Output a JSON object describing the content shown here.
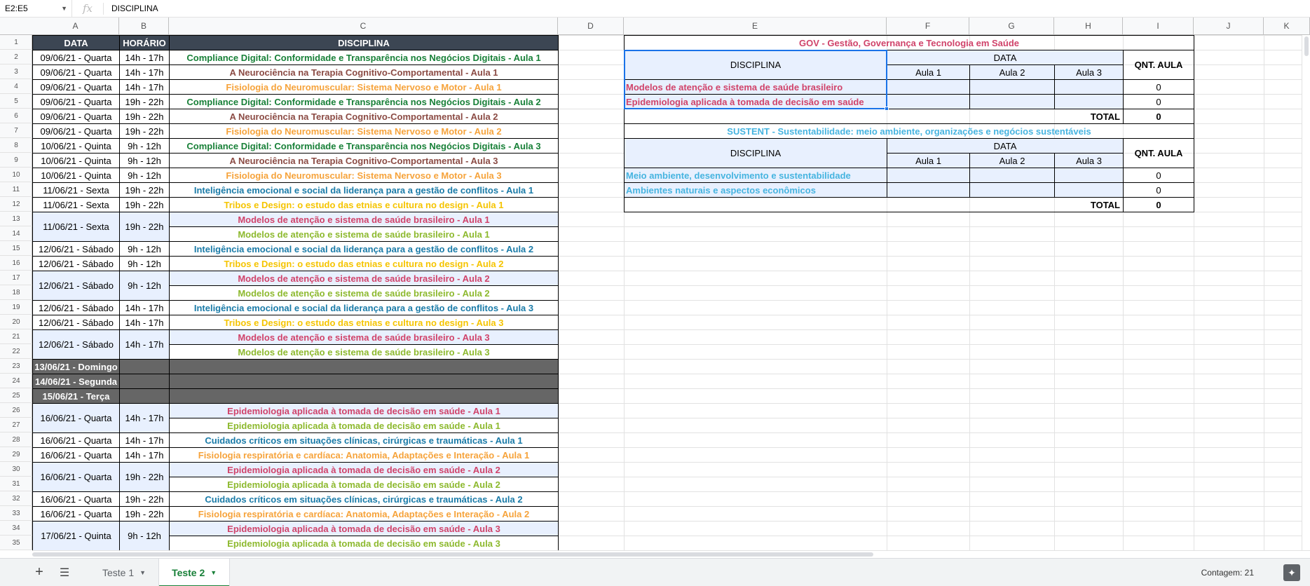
{
  "formula_bar": {
    "cell_ref": "E2:E5",
    "fx": "fx",
    "value": "DISCIPLINA"
  },
  "columns": [
    "A",
    "B",
    "C",
    "D",
    "E",
    "F",
    "G",
    "H",
    "I",
    "J",
    "K"
  ],
  "rows": [
    "1",
    "2",
    "3",
    "4",
    "5",
    "6",
    "7",
    "8",
    "9",
    "10",
    "11",
    "12",
    "13",
    "14",
    "15",
    "16",
    "17",
    "18",
    "19",
    "20",
    "21",
    "22",
    "23",
    "24",
    "25",
    "26",
    "27",
    "28",
    "29",
    "30",
    "31",
    "32",
    "33",
    "34",
    "35"
  ],
  "colors": {
    "green": "#188038",
    "brown": "#8b4b44",
    "orange": "#f6a33b",
    "blue": "#1a7ba8",
    "yellow": "#f5c400",
    "pink": "#d0436a",
    "lime": "#8db92e",
    "gov": "#d0436a",
    "sustent": "#46b4e0"
  },
  "table": {
    "headers": {
      "data": "DATA",
      "horario": "HORÁRIO",
      "disciplina": "DISCIPLINA"
    },
    "rows": [
      {
        "date": "09/06/21 - Quarta",
        "time": "14h - 17h",
        "subject": "Compliance Digital: Conformidade e Transparência nos Negócios Digitais - Aula 1",
        "color": "green"
      },
      {
        "date": "09/06/21 - Quarta",
        "time": "14h - 17h",
        "subject": "A Neurociência na Terapia Cognitivo-Comportamental - Aula 1",
        "color": "brown"
      },
      {
        "date": "09/06/21 - Quarta",
        "time": "14h - 17h",
        "subject": "Fisiologia do Neuromuscular: Sistema Nervoso e Motor - Aula 1",
        "color": "orange"
      },
      {
        "date": "09/06/21 - Quarta",
        "time": "19h - 22h",
        "subject": "Compliance Digital: Conformidade e Transparência nos Negócios Digitais - Aula 2",
        "color": "green"
      },
      {
        "date": "09/06/21 - Quarta",
        "time": "19h - 22h",
        "subject": "A Neurociência na Terapia Cognitivo-Comportamental - Aula 2",
        "color": "brown"
      },
      {
        "date": "09/06/21 - Quarta",
        "time": "19h - 22h",
        "subject": "Fisiologia do Neuromuscular: Sistema Nervoso e Motor - Aula 2",
        "color": "orange"
      },
      {
        "date": "10/06/21 - Quinta",
        "time": "9h - 12h",
        "subject": "Compliance Digital: Conformidade e Transparência nos Negócios Digitais - Aula 3",
        "color": "green"
      },
      {
        "date": "10/06/21 - Quinta",
        "time": "9h - 12h",
        "subject": "A Neurociência na Terapia Cognitivo-Comportamental - Aula 3",
        "color": "brown"
      },
      {
        "date": "10/06/21 - Quinta",
        "time": "9h - 12h",
        "subject": "Fisiologia do Neuromuscular: Sistema Nervoso e Motor - Aula 3",
        "color": "orange"
      },
      {
        "date": "11/06/21 - Sexta",
        "time": "19h - 22h",
        "subject": "Inteligência emocional e social da liderança para a gestão de conflitos - Aula 1",
        "color": "blue"
      },
      {
        "date": "11/06/21 - Sexta",
        "time": "19h - 22h",
        "subject": "Tribos e Design: o estudo das etnias e cultura no design - Aula 1",
        "color": "yellow"
      },
      {
        "date": "11/06/21 - Sexta",
        "time": "19h - 22h",
        "subject": "Modelos de atenção e sistema de saúde brasileiro - Aula 1",
        "color": "pink",
        "merged": true
      },
      {
        "subject": "Modelos de atenção e sistema de saúde brasileiro - Aula 1",
        "color": "lime",
        "merged_cont": true
      },
      {
        "date": "12/06/21 - Sábado",
        "time": "9h - 12h",
        "subject": "Inteligência emocional e social da liderança para a gestão de conflitos - Aula 2",
        "color": "blue"
      },
      {
        "date": "12/06/21 - Sábado",
        "time": "9h - 12h",
        "subject": "Tribos e Design: o estudo das etnias e cultura no design - Aula 2",
        "color": "yellow"
      },
      {
        "date": "12/06/21 - Sábado",
        "time": "9h - 12h",
        "subject": "Modelos de atenção e sistema de saúde brasileiro - Aula 2",
        "color": "pink",
        "merged": true
      },
      {
        "subject": "Modelos de atenção e sistema de saúde brasileiro - Aula 2",
        "color": "lime",
        "merged_cont": true
      },
      {
        "date": "12/06/21 - Sábado",
        "time": "14h - 17h",
        "subject": "Inteligência emocional e social da liderança para a gestão de conflitos - Aula 3",
        "color": "blue"
      },
      {
        "date": "12/06/21 - Sábado",
        "time": "14h - 17h",
        "subject": "Tribos e Design: o estudo das etnias e cultura no design - Aula 3",
        "color": "yellow"
      },
      {
        "date": "12/06/21 - Sábado",
        "time": "14h - 17h",
        "subject": "Modelos de atenção e sistema de saúde brasileiro - Aula 3",
        "color": "pink",
        "merged": true
      },
      {
        "subject": "Modelos de atenção e sistema de saúde brasileiro - Aula 3",
        "color": "lime",
        "merged_cont": true
      },
      {
        "date": "13/06/21 - Domingo",
        "dark": true
      },
      {
        "date": "14/06/21 - Segunda",
        "dark": true
      },
      {
        "date": "15/06/21 - Terça",
        "dark": true
      },
      {
        "date": "16/06/21 - Quarta",
        "time": "14h - 17h",
        "subject": "Epidemiologia aplicada à tomada de decisão em saúde - Aula 1",
        "color": "pink",
        "merged": true
      },
      {
        "subject": "Epidemiologia aplicada à tomada de decisão em saúde - Aula 1",
        "color": "lime",
        "merged_cont": true
      },
      {
        "date": "16/06/21 - Quarta",
        "time": "14h - 17h",
        "subject": "Cuidados críticos em situações clínicas, cirúrgicas e traumáticas - Aula 1",
        "color": "blue"
      },
      {
        "date": "16/06/21 - Quarta",
        "time": "14h - 17h",
        "subject": "Fisiologia respiratória e cardíaca: Anatomia, Adaptações e Interação - Aula 1",
        "color": "orange"
      },
      {
        "date": "16/06/21 - Quarta",
        "time": "19h - 22h",
        "subject": "Epidemiologia aplicada à tomada de decisão em saúde - Aula 2",
        "color": "pink",
        "merged": true
      },
      {
        "subject": "Epidemiologia aplicada à tomada de decisão em saúde - Aula 2",
        "color": "lime",
        "merged_cont": true
      },
      {
        "date": "16/06/21 - Quarta",
        "time": "19h - 22h",
        "subject": "Cuidados críticos em situações clínicas, cirúrgicas e traumáticas - Aula 2",
        "color": "blue"
      },
      {
        "date": "16/06/21 - Quarta",
        "time": "19h - 22h",
        "subject": "Fisiologia respiratória e cardíaca: Anatomia, Adaptações e Interação - Aula 2",
        "color": "orange"
      },
      {
        "date": "17/06/21 - Quinta",
        "time": "9h - 12h",
        "subject": "Epidemiologia aplicada à tomada de decisão em saúde - Aula 3",
        "color": "pink",
        "merged": true
      },
      {
        "subject": "Epidemiologia aplicada à tomada de decisão em saúde - Aula 3",
        "color": "lime",
        "merged_cont": true
      }
    ]
  },
  "gov": {
    "title": "GOV - Gestão, Governança e Tecnologia em Saúde",
    "disciplina": "DISCIPLINA",
    "data": "DATA",
    "aulas": [
      "Aula 1",
      "Aula 2",
      "Aula 3"
    ],
    "qnt": "QNT. AULA",
    "items": [
      {
        "name": "Modelos de atenção e sistema de saúde brasileiro",
        "qnt": "0"
      },
      {
        "name": "Epidemiologia aplicada à tomada de decisão em saúde",
        "qnt": "0"
      }
    ],
    "total_label": "TOTAL",
    "total": "0"
  },
  "sustent": {
    "title": "SUSTENT - Sustentabilidade: meio ambiente, organizações e negócios sustentáveis",
    "disciplina": "DISCIPLINA",
    "data": "DATA",
    "aulas": [
      "Aula 1",
      "Aula 2",
      "Aula 3"
    ],
    "qnt": "QNT. AULA",
    "items": [
      {
        "name": "Meio ambiente, desenvolvimento e sustentabilidade",
        "qnt": "0"
      },
      {
        "name": "Ambientes naturais e aspectos econômicos",
        "qnt": "0"
      }
    ],
    "total_label": "TOTAL",
    "total": "0"
  },
  "sheets": [
    {
      "name": "Teste 1",
      "active": false
    },
    {
      "name": "Teste 2",
      "active": true
    }
  ],
  "status": {
    "count": "Contagem: 21"
  }
}
